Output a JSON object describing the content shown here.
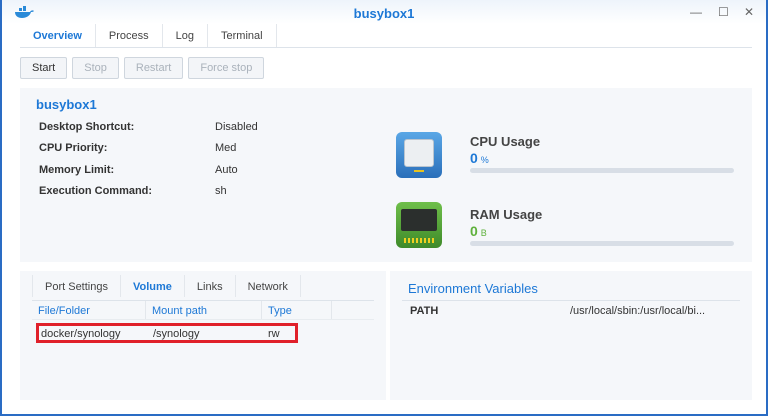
{
  "window": {
    "title": "busybox1",
    "minimize": "—",
    "maximize": "☐",
    "close": "✕"
  },
  "tabs": [
    "Overview",
    "Process",
    "Log",
    "Terminal"
  ],
  "actions": {
    "start": "Start",
    "stop": "Stop",
    "restart": "Restart",
    "force_stop": "Force stop"
  },
  "overview": {
    "name": "busybox1",
    "fields": [
      {
        "label": "Desktop Shortcut:",
        "value": "Disabled"
      },
      {
        "label": "CPU Priority:",
        "value": "Med"
      },
      {
        "label": "Memory Limit:",
        "value": "Auto"
      },
      {
        "label": "Execution Command:",
        "value": "sh"
      }
    ],
    "cpu": {
      "label": "CPU Usage",
      "value": "0",
      "unit": "%",
      "percent": 0,
      "color": "#1d78d6"
    },
    "ram": {
      "label": "RAM Usage",
      "value": "0",
      "unit": "B",
      "percent": 0,
      "color": "#5fb13c"
    }
  },
  "subtabs": [
    "Port Settings",
    "Volume",
    "Links",
    "Network"
  ],
  "volume": {
    "columns": [
      "File/Folder",
      "Mount path",
      "Type"
    ],
    "rows": [
      [
        "docker/synology",
        "/synology",
        "rw"
      ]
    ],
    "highlight_color": "#e0202a"
  },
  "env": {
    "title": "Environment Variables",
    "rows": [
      {
        "name": "PATH",
        "value": "/usr/local/sbin:/usr/local/bi..."
      }
    ]
  }
}
